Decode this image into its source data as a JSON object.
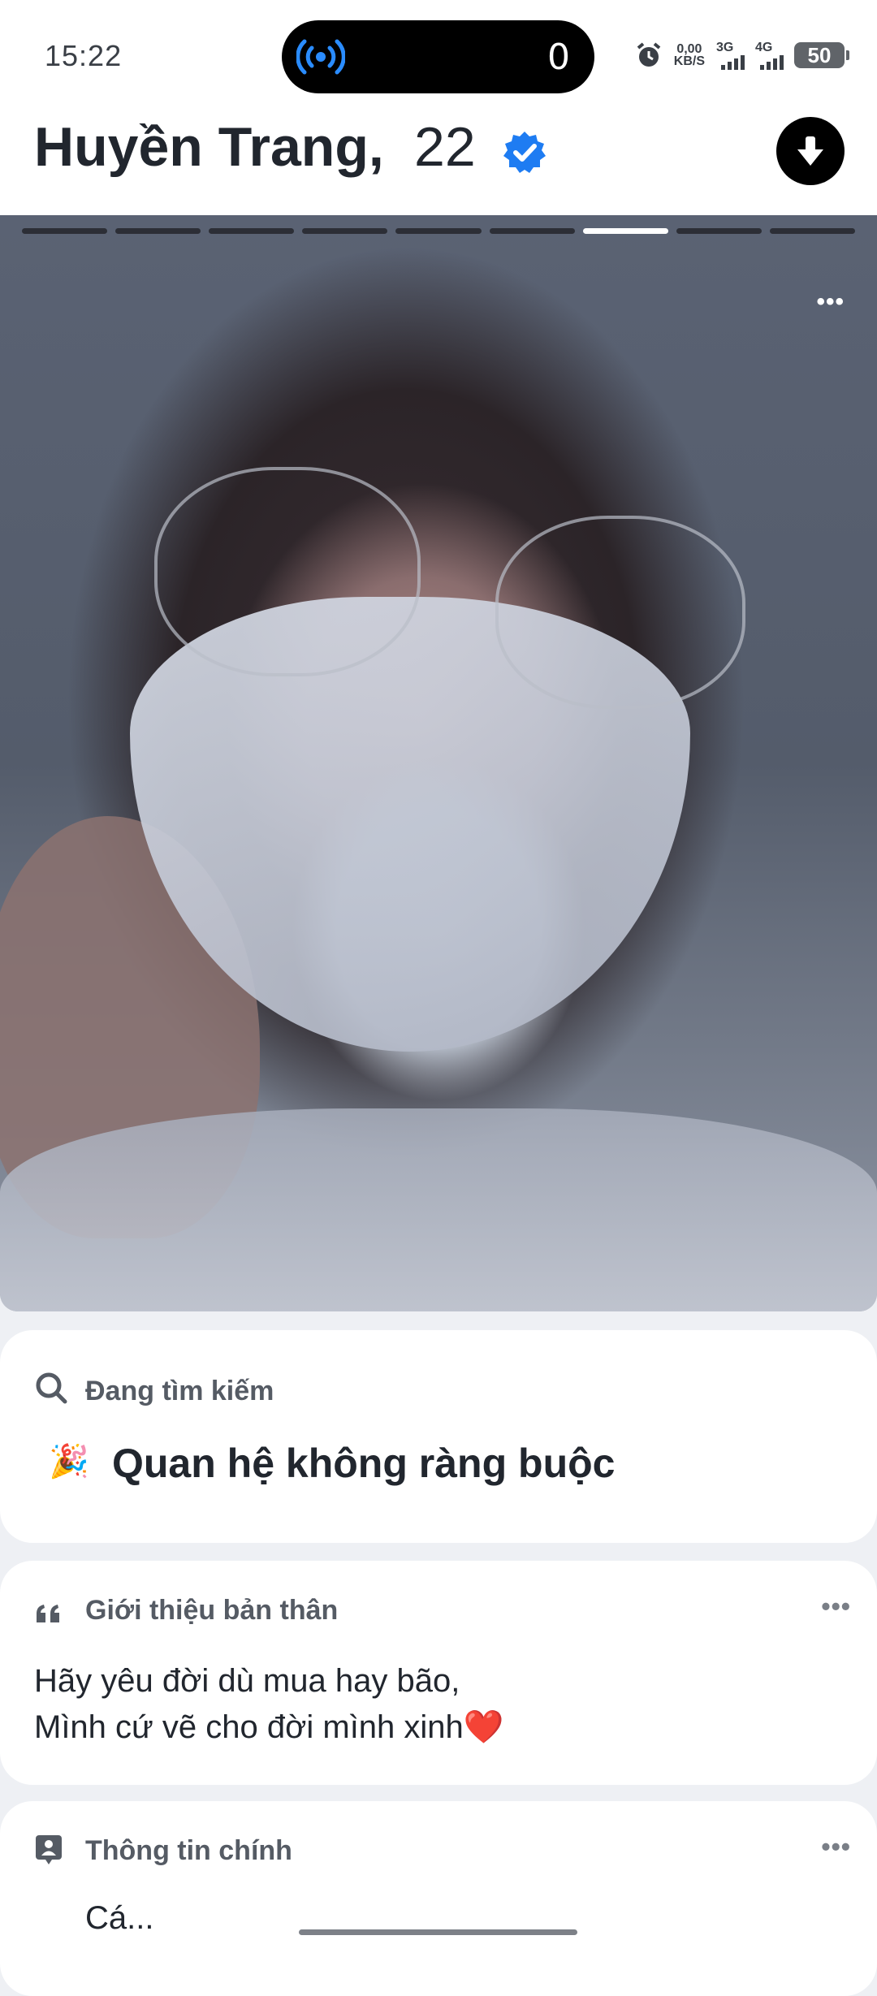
{
  "status_bar": {
    "time": "15:22",
    "island_count": "0",
    "net_speed_value": "0,00",
    "net_speed_unit": "KB/S",
    "sim1": "3G",
    "sim2": "4G",
    "battery": "50"
  },
  "profile": {
    "name": "Huyền Trang,",
    "age": "22",
    "verified": true,
    "photo_count": 9,
    "active_photo_index": 6
  },
  "looking_for": {
    "title": "Đang tìm kiếm",
    "emoji": "🎉",
    "value": "Quan hệ không ràng buộc"
  },
  "about": {
    "title": "Giới thiệu bản thân",
    "line1": "Hãy yêu đời dù mua hay bão,",
    "line2": "Mình cứ vẽ cho đời mình xinh❤️"
  },
  "basics": {
    "title": "Thông tin chính",
    "partial_row": "Cá..."
  },
  "more_label": "•••",
  "colors": {
    "verified_blue": "#1e7cf2",
    "island_icon_blue": "#2a8cff"
  }
}
